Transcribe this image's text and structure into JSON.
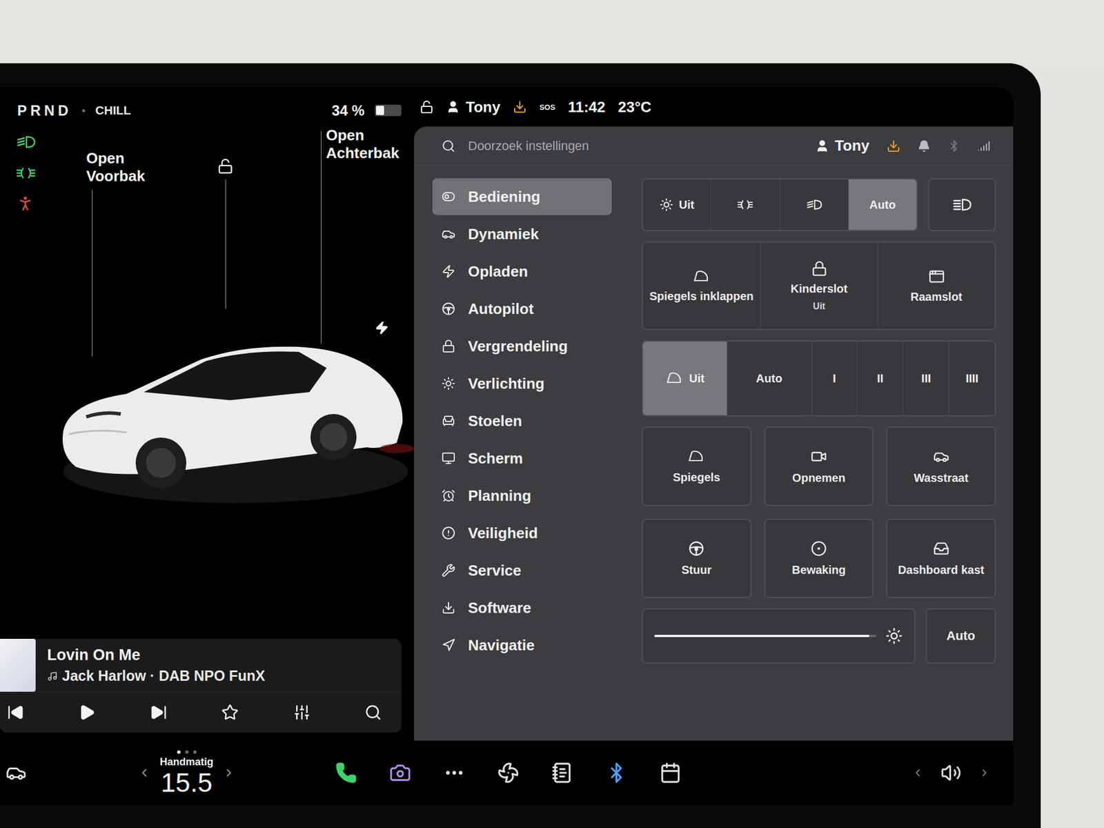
{
  "status": {
    "gear": "PRND",
    "mode": "CHILL",
    "battery": "34 %",
    "batteryLevel": 0.34
  },
  "indicators": [
    {
      "kind": "low-beam",
      "color": "#3fd16b"
    },
    {
      "kind": "parking",
      "color": "#3fd16b"
    },
    {
      "kind": "seatbelt",
      "color": "#e5483f"
    }
  ],
  "topBar": {
    "locked": false,
    "user": "Tony",
    "sos": "SOS",
    "time": "11:42",
    "temperature": "23°C"
  },
  "car": {
    "frunk": {
      "action": "Open",
      "target": "Voorbak"
    },
    "trunk": {
      "action": "Open",
      "target": "Achterbak"
    },
    "locked": false,
    "charging": true
  },
  "media": {
    "title": "Lovin On Me",
    "subtitle": "Jack Harlow · DAB NPO FunX",
    "playing": false,
    "favorite": false
  },
  "settings": {
    "search": {
      "placeholder": "Doorzoek instellingen"
    },
    "user": "Tony",
    "menu": [
      {
        "label": "Bediening",
        "kind": "toggle",
        "selected": true
      },
      {
        "label": "Dynamiek",
        "kind": "car",
        "selected": false
      },
      {
        "label": "Opladen",
        "kind": "bolt",
        "selected": false
      },
      {
        "label": "Autopilot",
        "kind": "wheel",
        "selected": false
      },
      {
        "label": "Vergrendeling",
        "kind": "lock",
        "selected": false
      },
      {
        "label": "Verlichting",
        "kind": "sun",
        "selected": false
      },
      {
        "label": "Stoelen",
        "kind": "seat",
        "selected": false
      },
      {
        "label": "Scherm",
        "kind": "screen",
        "selected": false
      },
      {
        "label": "Planning",
        "kind": "alarm",
        "selected": false
      },
      {
        "label": "Veiligheid",
        "kind": "alert",
        "selected": false
      },
      {
        "label": "Service",
        "kind": "wrench",
        "selected": false
      },
      {
        "label": "Software",
        "kind": "download",
        "selected": false
      },
      {
        "label": "Navigatie",
        "kind": "navigation",
        "selected": false
      }
    ]
  },
  "lights": [
    {
      "kind": "off",
      "label": "Uit",
      "selected": false
    },
    {
      "kind": "parking",
      "selected": false
    },
    {
      "kind": "low-beam",
      "selected": false
    },
    {
      "kind": "auto",
      "label": "Auto",
      "selected": true
    }
  ],
  "highBeam": {
    "on": false
  },
  "tiles": [
    {
      "kind": "fold-mirrors",
      "label": "Spiegels inklappen"
    },
    {
      "kind": "child-lock",
      "label": "Kinderslot",
      "value": "Uit"
    },
    {
      "kind": "window-lock",
      "label": "Raamslot"
    }
  ],
  "wipers": [
    {
      "label": "Uit",
      "kind": "off",
      "selected": true
    },
    {
      "label": "Auto",
      "kind": "auto",
      "selected": false
    },
    {
      "label": "I",
      "kind": "speed",
      "selected": false
    },
    {
      "label": "II",
      "kind": "speed",
      "selected": false
    },
    {
      "label": "III",
      "kind": "speed",
      "selected": false
    },
    {
      "label": "IIII",
      "kind": "speed",
      "selected": false
    }
  ],
  "quick": [
    {
      "kind": "mirror-adjust",
      "label": "Spiegels"
    },
    {
      "kind": "record",
      "label": "Opnemen"
    },
    {
      "kind": "car-wash",
      "label": "Wasstraat"
    },
    {
      "kind": "steering-adjust",
      "label": "Stuur"
    },
    {
      "kind": "sentry",
      "label": "Bewaking"
    },
    {
      "kind": "glovebox",
      "label": "Dashboard kast"
    }
  ],
  "brightness": {
    "level": 0.97,
    "auto": "Auto"
  },
  "dock": {
    "climate": {
      "mode": "Handmatig",
      "temperature": "15.5"
    },
    "pages": [
      {
        "selected": true
      },
      {
        "selected": false
      },
      {
        "selected": false
      }
    ]
  }
}
